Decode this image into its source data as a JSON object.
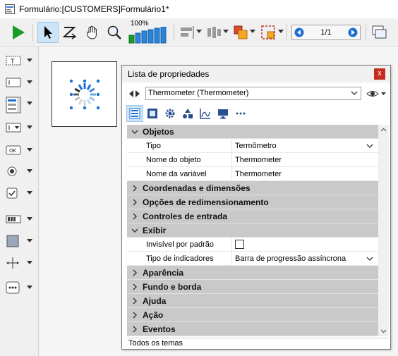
{
  "window": {
    "title": "Formulário:[CUSTOMERS]Formulário1*"
  },
  "toolbar": {
    "zoom_label": "100%",
    "page_indicator": "1/1"
  },
  "property_list": {
    "title": "Lista de propriedades",
    "close_label": "x",
    "object_selector": "Thermometer (Thermometer)",
    "groups": [
      {
        "label": "Objetos",
        "expanded": true,
        "props": [
          {
            "name": "Tipo",
            "value": "Termômetro",
            "dropdown": true
          },
          {
            "name": "Nome do objeto",
            "value": "Thermometer"
          },
          {
            "name": "Nome da variável",
            "value": "Thermometer"
          }
        ]
      },
      {
        "label": "Coordenadas e dimensões",
        "expanded": false
      },
      {
        "label": "Opções de redimensionamento",
        "expanded": false
      },
      {
        "label": "Controles de entrada",
        "expanded": false
      },
      {
        "label": "Exibir",
        "expanded": true,
        "props": [
          {
            "name": "Invisível por padrão",
            "checkbox": true,
            "checked": false
          },
          {
            "name": "Tipo de indicadores",
            "value": "Barra de progressão assíncrona",
            "dropdown": true
          }
        ]
      },
      {
        "label": "Aparência",
        "expanded": false
      },
      {
        "label": "Fundo e borda",
        "expanded": false
      },
      {
        "label": "Ajuda",
        "expanded": false
      },
      {
        "label": "Ação",
        "expanded": false
      },
      {
        "label": "Eventos",
        "expanded": false
      }
    ],
    "status": "Todos os temas"
  },
  "colors": {
    "accent_blue": "#1c6fd1",
    "play_green": "#1a9a2a",
    "close_red": "#c42b1c",
    "group_bg": "#c9c9c9"
  }
}
